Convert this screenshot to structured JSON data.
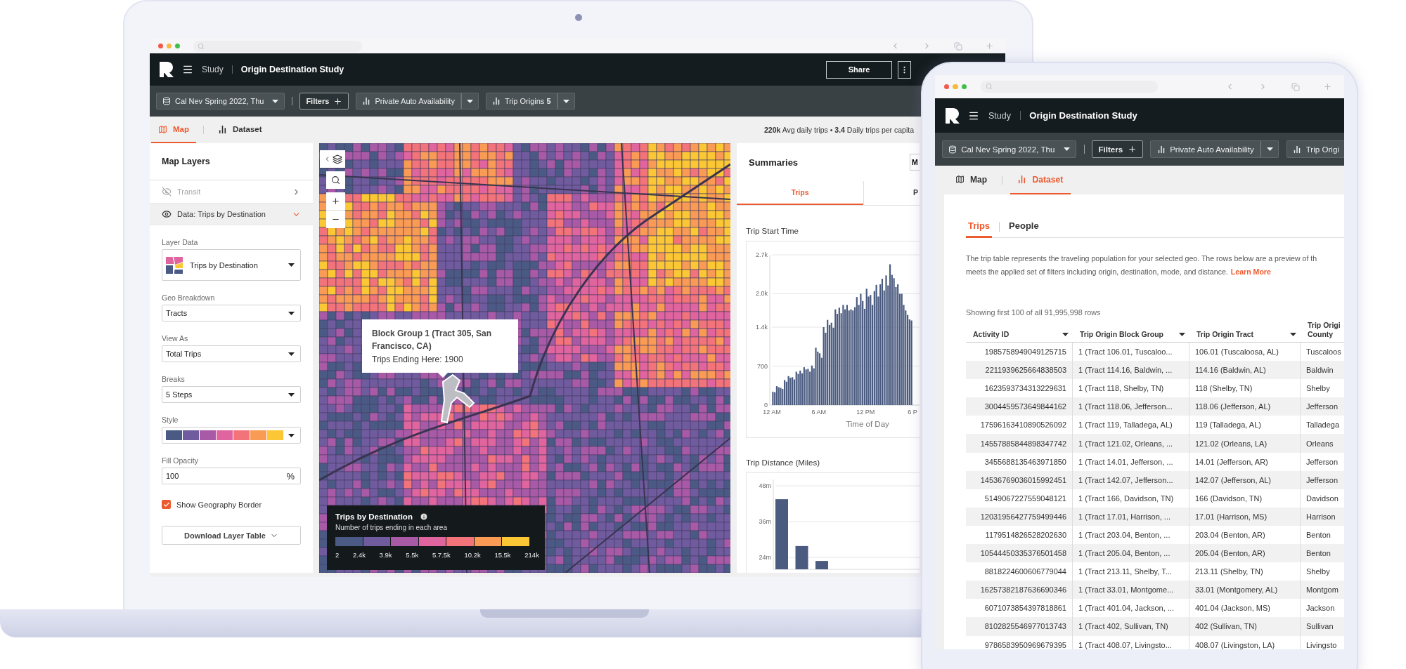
{
  "laptop": {
    "header": {
      "breadcrumb": "Study",
      "title": "Origin Destination Study",
      "share_button": "Share"
    },
    "toolbar": {
      "dataset": "Cal Nev Spring 2022, Thu",
      "filters": "Filters",
      "metrics": [
        {
          "label": "Private Auto Availability",
          "split": true
        },
        {
          "label": "Trip Origins **5**",
          "split": true
        }
      ]
    },
    "view_tabs": [
      {
        "label": "Map",
        "kind": "map",
        "selected": true
      },
      {
        "label": "Dataset",
        "kind": "dataset",
        "selected": false
      }
    ],
    "stats": "**220k** Avg daily trips • **3.4** Daily trips per capita",
    "map_layers": {
      "title": "Map Layers",
      "layers": [
        {
          "label": "Transit",
          "visible": false,
          "expanded": false
        },
        {
          "label": "Data: Trips by Destination",
          "visible": true,
          "expanded": true
        }
      ],
      "fields": [
        {
          "kind": "layer",
          "label": "Layer Data",
          "value": "Trips by Destination"
        },
        {
          "kind": "select",
          "label": "Geo Breakdown",
          "value": "Tracts"
        },
        {
          "kind": "select",
          "label": "View As",
          "value": "Total Trips"
        },
        {
          "kind": "select",
          "label": "Breaks",
          "value": "5 Steps"
        },
        {
          "kind": "style",
          "label": "Style",
          "swatches": [
            {
              "color": "#4a5a85"
            },
            {
              "color": "#6f5b9e"
            },
            {
              "color": "#a95aa6"
            },
            {
              "color": "#e0649e"
            },
            {
              "color": "#f3737a"
            },
            {
              "color": "#f99b55"
            },
            {
              "color": "#fcc734"
            }
          ]
        },
        {
          "kind": "number",
          "label": "Fill Opacity",
          "value": "100",
          "unit": "%"
        }
      ],
      "checkbox": {
        "label": "Show Geography Border",
        "checked": true
      },
      "download_button": "Download Layer Table"
    },
    "map": {
      "tooltip": {
        "title": "Block Group 1 (Tract 305, San Francisco, CA)",
        "line": "Trips Ending Here: 1900"
      },
      "legend": {
        "title": "Trips by Destination",
        "subtitle": "Number of trips ending in each area",
        "steps": [
          {
            "color": "#4a5a85"
          },
          {
            "color": "#6f5b9e"
          },
          {
            "color": "#a95aa6"
          },
          {
            "color": "#e0649e"
          },
          {
            "color": "#f3737a"
          },
          {
            "color": "#f99b55"
          },
          {
            "color": "#fcc734"
          }
        ],
        "labels": [
          "2",
          "2.4k",
          "3.9k",
          "5.5k",
          "5.7.5k",
          "10.2k",
          "15.5k",
          "214k"
        ]
      }
    },
    "summaries": {
      "title": "Summaries",
      "menu_button": "M",
      "tabs": [
        {
          "label": "Trips",
          "selected": true
        },
        {
          "label": "P",
          "selected": false
        }
      ],
      "charts": [
        {
          "x_labels": [
            "12 AM",
            "6 AM",
            "12 PM",
            "6 P"
          ],
          "chart_data": {
            "type": "bar",
            "title": "Trip Start Time",
            "xlabel": "Time of Day",
            "series": [
              {
                "color": "#4b5b80",
                "values": [
                  240,
                  230,
                  340,
                  320,
                  310,
                  290,
                  450,
                  420,
                  520,
                  490,
                  500,
                  460,
                  600,
                  560,
                  620,
                  570,
                  680,
                  640,
                  650,
                  600,
                  710,
                  660,
                  1030,
                  960,
                  930,
                  850,
                  1400,
                  1300,
                  1530,
                  1440,
                  1480,
                  1390,
                  1720,
                  1640,
                  1750,
                  1650,
                  1800,
                  1720,
                  1800,
                  1700,
                  1720,
                  1700,
                  1760,
                  1940,
                  1800,
                  2000,
                  1870,
                  1730,
                  2090,
                  1950,
                  1980,
                  1800,
                  2050,
                  2160,
                  1950,
                  2170,
                  2270,
                  2060,
                  2330,
                  2150,
                  2530,
                  2340,
                  2280,
                  2120,
                  2170,
                  2000,
                  2000,
                  1800,
                  1700,
                  1620,
                  1540,
                  1520
                ]
              }
            ],
            "ylim": [
              0,
              2700
            ],
            "grid": true,
            "yticks": [
              0,
              700,
              {
                "value": 1400,
                "label": "1.4k"
              },
              {
                "value": 2000,
                "label": "2.0k"
              },
              {
                "value": 2700,
                "label": "2.7k"
              }
            ]
          }
        },
        {
          "chart_data": {
            "type": "bar",
            "title": "Trip Distance (Miles)",
            "series": [
              {
                "color": "#4b5b80",
                "values": [
                  43.5,
                  27.8,
                  22.8
                ]
              }
            ],
            "ylim": [
              20,
              50
            ],
            "grid": true,
            "yticks": [
              {
                "value": 24,
                "label": "24m"
              },
              {
                "value": 36,
                "label": "36m"
              },
              {
                "value": 48,
                "label": "48m"
              }
            ]
          }
        }
      ]
    }
  },
  "tablet": {
    "header": {
      "breadcrumb": "Study",
      "title": "Origin Destination Study"
    },
    "toolbar": {
      "dataset": "Cal Nev Spring 2022, Thu",
      "filters": "Filters",
      "metrics": [
        {
          "label": "Private Auto Availability",
          "split": true
        },
        {
          "label": "Trip Origi",
          "split": false
        }
      ]
    },
    "view_tabs": [
      {
        "label": "Map",
        "kind": "map",
        "selected": false
      },
      {
        "label": "Dataset",
        "kind": "dataset",
        "selected": true
      }
    ],
    "sub_tabs": [
      {
        "label": "Trips",
        "selected": true
      },
      {
        "label": "People",
        "selected": false
      }
    ],
    "description": {
      "lines": [
        "The trip table represents the traveling population for your selected geo. The rows below are a preview of th",
        "meets the applied set of filters including origin, destination, mode, and distance."
      ],
      "link": "Learn More"
    },
    "row_count": "Showing first 100 of all 91,995,998 rows",
    "table": {
      "columns": [
        {
          "label": "Activity ID",
          "sortable": true
        },
        {
          "label": "Trip Origin Block Group",
          "sortable": true
        },
        {
          "label": "Trip Origin Tract",
          "sortable": true
        },
        {
          "label": "Trip Origi County",
          "sortable": false
        }
      ],
      "rows": [
        [
          "1985758949049125715",
          "1 (Tract 106.01, Tuscaloo...",
          "106.01 (Tuscaloosa, AL)",
          "Tuscaloos"
        ],
        [
          "2211939625664838503",
          "1 (Tract 114.16, Baldwin, ...",
          "114.16 (Baldwin, AL)",
          "Baldwin"
        ],
        [
          "1623593734313229631",
          "1 (Tract 118, Shelby, TN)",
          "118 (Shelby, TN)",
          "Shelby"
        ],
        [
          "3004459573649844162",
          "1 (Tract 118.06, Jefferson...",
          "118.06 (Jefferson, AL)",
          "Jefferson"
        ],
        [
          "17596163410890526092",
          "1 (Tract 119, Talladega, AL)",
          "119 (Talladega, AL)",
          "Talladega"
        ],
        [
          "14557885844898347742",
          "1 (Tract 121.02, Orleans, ...",
          "121.02 (Orleans, LA)",
          "Orleans"
        ],
        [
          "3455688135463971850",
          "1 (Tract 14.01, Jefferson, ...",
          "14.01 (Jefferson, AR)",
          "Jefferson"
        ],
        [
          "14536769036015992451",
          "1 (Tract 142.07, Jefferson...",
          "142.07 (Jefferson, AL)",
          "Jefferson"
        ],
        [
          "5149067227559048121",
          "1 (Tract 166, Davidson, TN)",
          "166 (Davidson, TN)",
          "Davidson"
        ],
        [
          "12031956427759499446",
          "1 (Tract 17.01, Harrison, ...",
          "17.01 (Harrison, MS)",
          "Harrison"
        ],
        [
          "1179514826528202630",
          "1 (Tract 203.04, Benton, ...",
          "203.04 (Benton, AR)",
          "Benton"
        ],
        [
          "10544450335376501458",
          "1 (Tract 205.04, Benton, ...",
          "205.04 (Benton, AR)",
          "Benton"
        ],
        [
          "8818224600606779044",
          "1 (Tract 213.11, Shelby, T...",
          "213.11 (Shelby, TN)",
          "Shelby"
        ],
        [
          "16257382187636690346",
          "1 (Tract 33.01, Montgome...",
          "33.01 (Montgomery, AL)",
          "Montgom"
        ],
        [
          "6071073854397818861",
          "1 (Tract 401.04, Jackson, ...",
          "401.04 (Jackson, MS)",
          "Jackson"
        ],
        [
          "8102825546977013743",
          "1 (Tract 402, Sullivan, TN)",
          "402 (Sullivan, TN)",
          "Sullivan"
        ],
        [
          "9786583950969679395",
          "1 (Tract 408.07, Livingsto...",
          "408.07 (Livingston, LA)",
          "Livingsto"
        ]
      ]
    }
  }
}
